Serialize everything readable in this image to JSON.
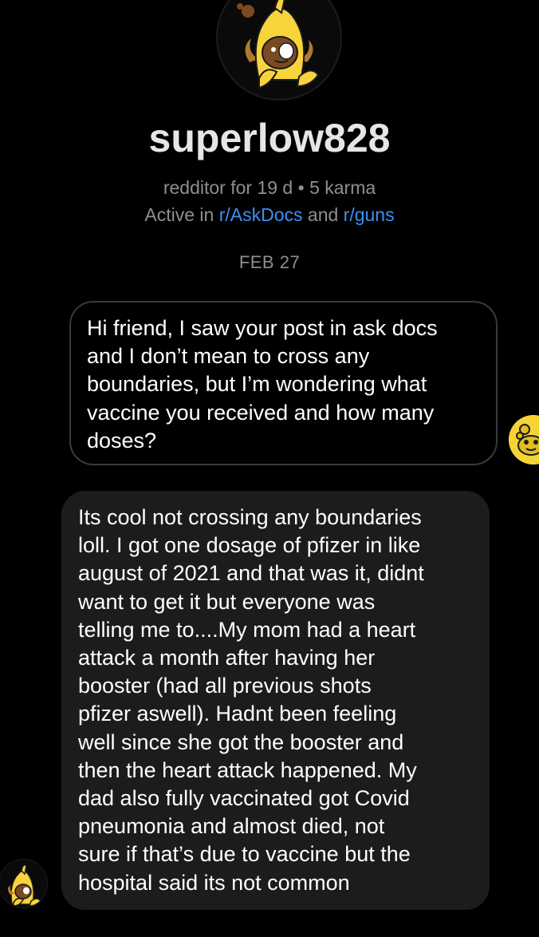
{
  "profile": {
    "username": "superlow828",
    "age_text": "redditor for 19 d",
    "separator": "•",
    "karma_text": "5 karma",
    "active_prefix": "Active in",
    "active_conjunction": "and",
    "communities": [
      "r/AskDocs",
      "r/guns"
    ],
    "avatar_icon": "banana-snoo-avatar-icon"
  },
  "conversation": {
    "date_label": "FEB 27",
    "messages": [
      {
        "direction": "outgoing",
        "text": "Hi friend, I saw your post in ask docs\nand I don’t mean to cross any\nboundaries, but I’m wondering what\nvaccine you received and how many\ndoses?"
      },
      {
        "direction": "incoming",
        "text": "Its cool not crossing any boundaries\nloll. I got one dosage of pfizer in like\naugust of 2021 and that was it, didnt\nwant to get it but everyone was\ntelling me to....My mom had a heart\nattack a month after having her\nbooster (had all previous shots\npfizer aswell). Hadnt been feeling\nwell since she got the booster and\nthen the heart attack happened. My\ndad also fully vaccinated got Covid\npneumonia and almost died, not\nsure if that’s due to vaccine but the\nhospital said its not common"
      }
    ]
  },
  "colors": {
    "background": "#000000",
    "muted_text": "#8e8e93",
    "link": "#3e8ef7",
    "incoming_bubble": "#1c1c1e",
    "outgoing_border": "#3a3a3c",
    "avatar_yellow": "#f4d435"
  }
}
